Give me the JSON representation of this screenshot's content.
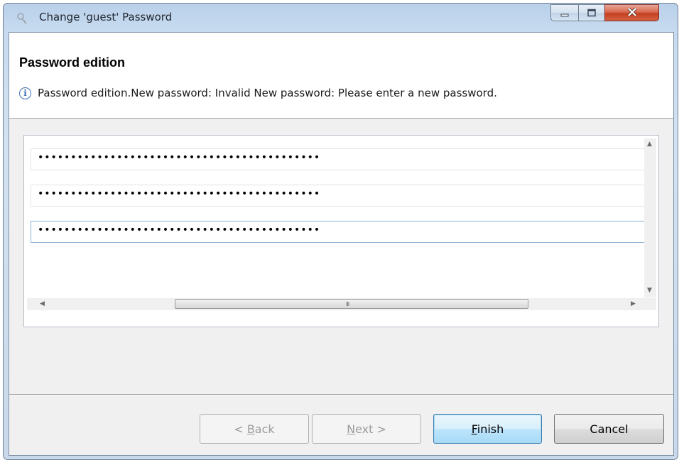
{
  "window": {
    "title": "Change 'guest' Password"
  },
  "header": {
    "title": "Password edition",
    "icon": "info-icon",
    "message": "Password edition.New password: Invalid New password: Please enter a new password."
  },
  "fields": [
    {
      "value": "•••••••••••••••••••••••••••••••••••••••••••"
    },
    {
      "value": "•••••••••••••••••••••••••••••••••••••••••••"
    },
    {
      "value": "•••••••••••••••••••••••••••••••••••••••••••"
    }
  ],
  "scrollbar": {
    "grip": "III"
  },
  "buttons": {
    "back": {
      "pre": "< ",
      "mnemonic": "B",
      "post": "ack"
    },
    "next": {
      "pre": "",
      "mnemonic": "N",
      "post": "ext >"
    },
    "finish": {
      "pre": "",
      "mnemonic": "F",
      "post": "inish"
    },
    "cancel": {
      "pre": "Cancel",
      "mnemonic": "",
      "post": ""
    }
  },
  "colors": {
    "accent": "#3c7fb1",
    "info": "#3a6fb6",
    "close": "#c4401f"
  }
}
